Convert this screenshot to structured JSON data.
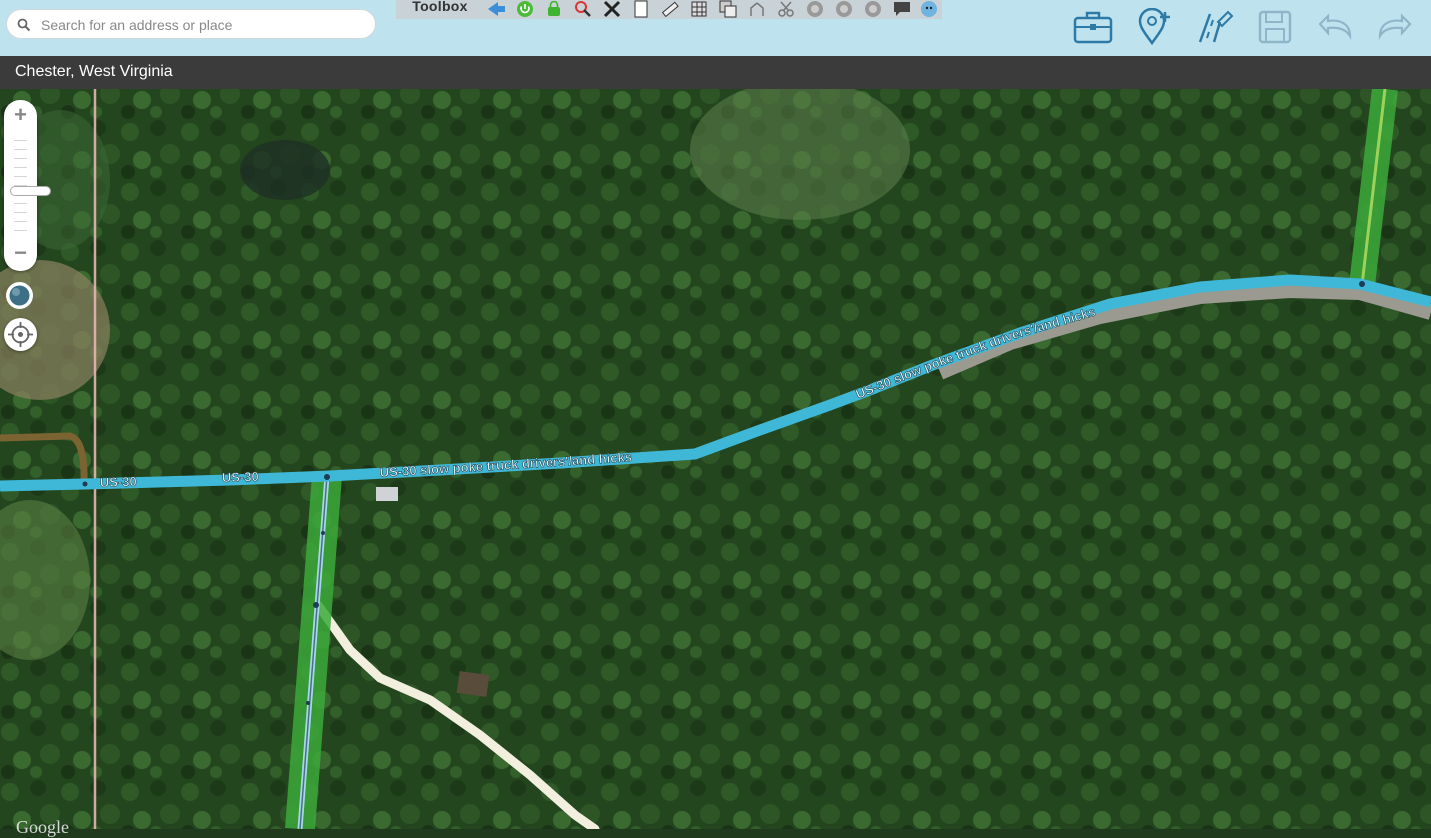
{
  "search": {
    "placeholder": "Search for an address or place"
  },
  "toolbox": {
    "label": "Toolbox",
    "icons": [
      "back-arrow-icon",
      "power-icon",
      "lock-icon",
      "magnify-red-icon",
      "tools-icon",
      "page-icon",
      "ruler-icon",
      "grid-icon",
      "copy-icon",
      "junction-icon",
      "scissors-icon",
      "circle-1-icon",
      "circle-2-icon",
      "circle-3-icon",
      "comment-icon",
      "wazer-icon"
    ]
  },
  "top_icons": [
    "briefcase-icon",
    "place-pin-icon",
    "road-edit-icon",
    "save-icon",
    "undo-icon",
    "redo-icon"
  ],
  "location": {
    "title": "Chester, West Virginia"
  },
  "map": {
    "road_label_short": "US-30",
    "road_label_long": "US-30 slow poke truck drivers'/and hicks",
    "attribution": "Google",
    "colors": {
      "primary_road": "#3fb8d8",
      "selected_segment": "#3ca93a",
      "private_road": "#f3efdf",
      "dirt_road": "#7b6432",
      "boundary": "#e8b4b4"
    }
  },
  "zoom": {
    "plus": "+",
    "minus": "−",
    "level_fraction": 0.36
  }
}
